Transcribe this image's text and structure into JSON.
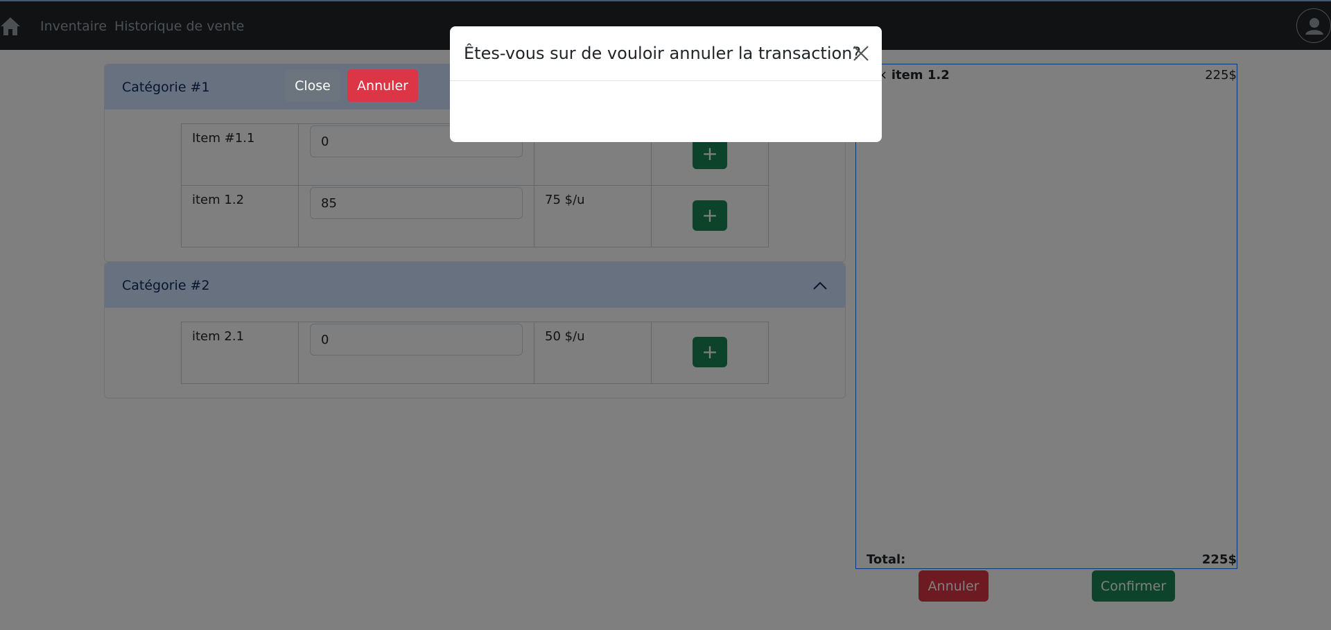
{
  "navbar": {
    "home_icon": "home-icon",
    "links": [
      "Inventaire",
      "Historique de vente"
    ],
    "avatar_icon": "user-icon"
  },
  "categories": [
    {
      "title": "Catégorie #1",
      "items": [
        {
          "name": "Item #1.1",
          "qty": "0",
          "price": ""
        },
        {
          "name": "item 1.2",
          "qty": "85",
          "price": "75 $/u"
        }
      ]
    },
    {
      "title": "Catégorie #2",
      "items": [
        {
          "name": "item 2.1",
          "qty": "0",
          "price": "50 $/u"
        }
      ]
    }
  ],
  "add_button_label": "+",
  "cart": {
    "line_name": "item 1.2",
    "line_prefix": "×",
    "line_amount": "225$",
    "total_label": "Total:",
    "total_amount": "225$",
    "cancel_label": "Annuler",
    "confirm_label": "Confirmer"
  },
  "modal": {
    "title": "Êtes-vous sur de vouloir annuler la transaction?",
    "close_label": "Close",
    "cancel_label": "Annuler"
  },
  "colors": {
    "navbar_bg": "#212529",
    "accordion_header": "#cfe2ff",
    "success": "#198754",
    "danger": "#dc3545",
    "secondary": "#6c757d"
  }
}
